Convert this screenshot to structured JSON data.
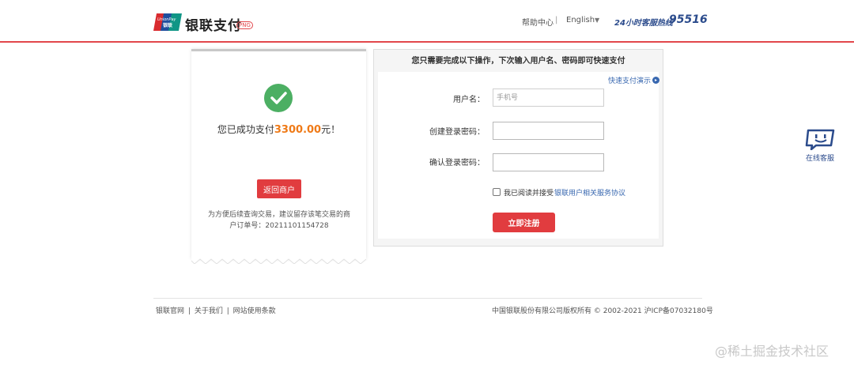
{
  "header": {
    "logo_alt": "UnionPay 银联",
    "brand_name": "银联支付",
    "brand_badge": "PNG",
    "help_label": "帮助中心",
    "separator": "|",
    "language_label": "English",
    "caret": "▼",
    "hotline_label": "24小时客服热线",
    "hotline_number": "95516",
    "accent_color": "#e2474b"
  },
  "receipt": {
    "success_prefix": "您已成功支付",
    "amount": "3300.00",
    "success_suffix": "元！",
    "back_button": "返回商户",
    "note_line1": "为方便后续查询交易，建议留存该笔交易的商",
    "note_line2": "户订单号：20211101154728",
    "success_color": "#4caf63"
  },
  "register": {
    "title": "您只需要完成以下操作，下次输入用户名、密码即可快速支付",
    "demo_link": "快速支付演示",
    "demo_icon": "▸",
    "username_label": "用户名：",
    "username_placeholder": "手机号",
    "password_label": "创建登录密码：",
    "confirm_label": "确认登录密码：",
    "agree_text": "我已阅读并接受",
    "agreement_link": "银联用户相关服务协议",
    "submit_button": "立即注册"
  },
  "service": {
    "label": "在线客服"
  },
  "footer": {
    "links": [
      "银联官网",
      "|",
      "关于我们",
      "|",
      "网站使用条款"
    ],
    "copyright": "中国银联股份有限公司版权所有 © 2002-2021  沪ICP备07032180号"
  },
  "watermark": "@稀土掘金技术社区"
}
